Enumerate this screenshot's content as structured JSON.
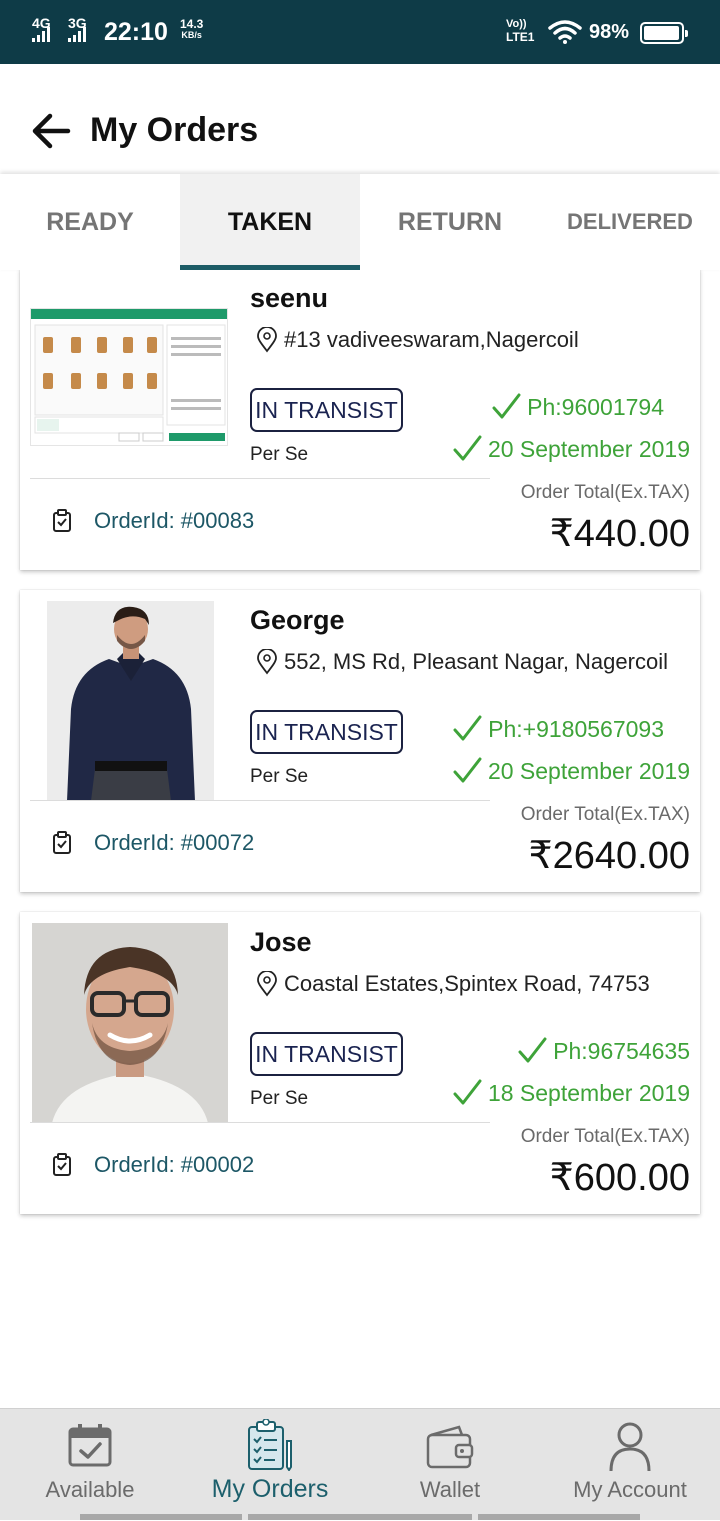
{
  "status_bar": {
    "network1": "4G",
    "network2": "3G",
    "time": "22:10",
    "speed_value": "14.3",
    "speed_unit": "KB/s",
    "volte_top": "Vo))",
    "volte_bottom": "LTE1",
    "battery_percent": "98%",
    "battery_level": 0.98
  },
  "header": {
    "title": "My Orders",
    "back_icon": "arrow-left-icon"
  },
  "tabs": [
    {
      "label": "READY",
      "active": false
    },
    {
      "label": "TAKEN",
      "active": true
    },
    {
      "label": "RETURN",
      "active": false
    },
    {
      "label": "DELIVERED",
      "active": false
    }
  ],
  "orders": [
    {
      "customer": "seenu",
      "address": "#13 vadiveeswaram,Nagercoil",
      "status": "IN TRANSIST",
      "shipping": "Per Se",
      "phone": "Ph:96001794",
      "date": "20 September 2019",
      "total_label": "Order Total(Ex.TAX)",
      "order_id": "OrderId: #00083",
      "amount": "₹440.00",
      "image": "pos-screenshot"
    },
    {
      "customer": "George",
      "address": "552, MS Rd, Pleasant Nagar, Nagercoil",
      "status": "IN TRANSIST",
      "shipping": "Per Se",
      "phone": "Ph:+9180567093",
      "date": "20 September 2019",
      "total_label": "Order Total(Ex.TAX)",
      "order_id": "OrderId: #00072",
      "amount": "₹2640.00",
      "image": "man-in-shirt-photo"
    },
    {
      "customer": "Jose",
      "address": "Coastal Estates,Spintex Road, 74753",
      "status": "IN TRANSIST",
      "shipping": "Per Se",
      "phone": "Ph:96754635",
      "date": "18 September 2019",
      "total_label": "Order Total(Ex.TAX)",
      "order_id": "OrderId: #00002",
      "amount": "₹600.00",
      "image": "man-portrait-photo"
    }
  ],
  "bottom_nav": [
    {
      "label": "Available",
      "icon": "calendar-check-icon",
      "active": false
    },
    {
      "label": "My Orders",
      "icon": "clipboard-list-icon",
      "active": true
    },
    {
      "label": "Wallet",
      "icon": "wallet-icon",
      "active": false
    },
    {
      "label": "My Account",
      "icon": "user-icon",
      "active": false
    }
  ],
  "colors": {
    "status_bar": "#0e3b47",
    "accent": "#1d5c66",
    "success_green": "#3ea339",
    "order_id": "#1d5766"
  }
}
